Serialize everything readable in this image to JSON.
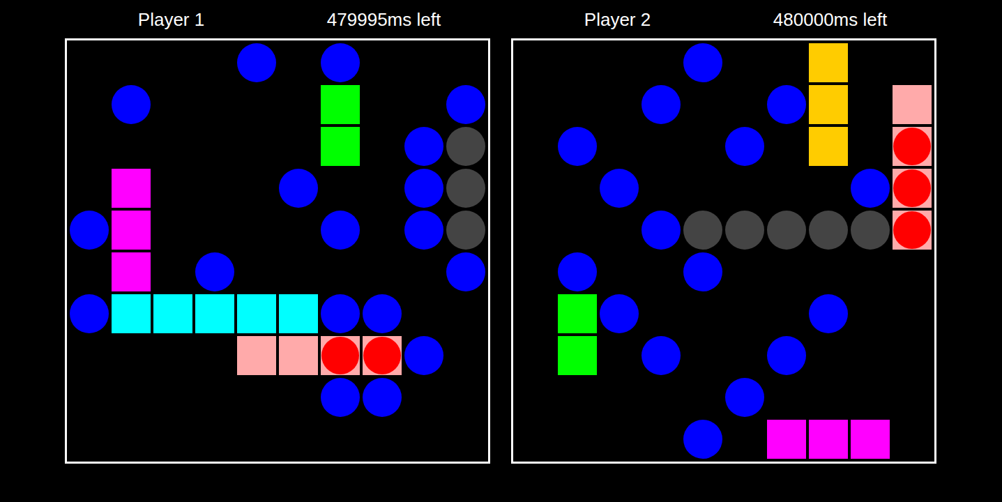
{
  "boards": [
    {
      "player": "Player 1",
      "time_left": "479995ms left",
      "grid": [
        "....o.o...",
        ".o....G..o",
        "......G.os",
        ".M...o..os",
        "oM....o.os",
        ".M.o.....o",
        "oCCCCCoo..",
        "....PPHHo.",
        "......oo..",
        ".........."
      ]
    },
    {
      "player": "Player 2",
      "time_left": "480000ms left",
      "grid": [
        "....o..Y..",
        "...o..oY.P",
        ".o...o.Y.H",
        "..o.....oH",
        "...osssssH",
        ".o..o.....",
        ".Go....o..",
        ".G.o..o...",
        ".....o....",
        "....o.MMM."
      ]
    }
  ],
  "legend": {
    ".": {
      "kind": "empty"
    },
    "o": {
      "kind": "miss",
      "color": "#0000ff"
    },
    "s": {
      "kind": "sunk",
      "color": "#444444"
    },
    "G": {
      "kind": "ship",
      "color": "#00ff00"
    },
    "M": {
      "kind": "ship",
      "color": "#ff00ff"
    },
    "C": {
      "kind": "ship",
      "color": "#00ffff"
    },
    "Y": {
      "kind": "ship",
      "color": "#ffcc00"
    },
    "P": {
      "kind": "ship",
      "color": "#ffaaaa"
    },
    "H": {
      "kind": "hit",
      "color": "#ffaaaa",
      "mark": "#ff0000"
    }
  }
}
